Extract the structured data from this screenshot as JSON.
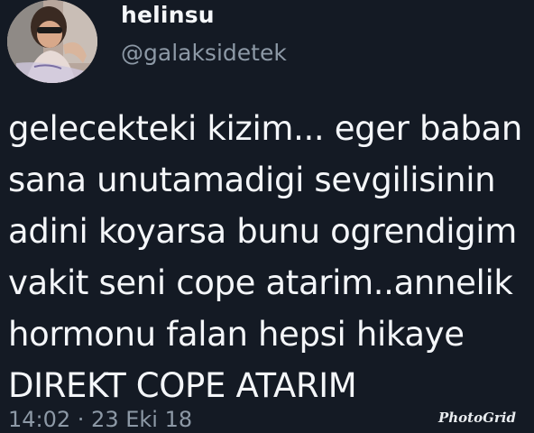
{
  "tweet": {
    "author_name": "helinsu",
    "author_handle": "@galaksidetek",
    "text": "gelecekteki kizim... eger baban\nsana unutamadigi sevgilisinin\nadini koyarsa bunu ogrendigim\nvakit seni cope atarim..annelik\nhormonu falan hepsi hikaye\nDIREKT COPE ATARIM",
    "timestamp": "14:02 · 23 Eki 18"
  },
  "watermark": "PhotoGrid",
  "colors": {
    "background": "#141a24",
    "primary_text": "#f4f6f9",
    "secondary_text": "#8d99a6"
  }
}
